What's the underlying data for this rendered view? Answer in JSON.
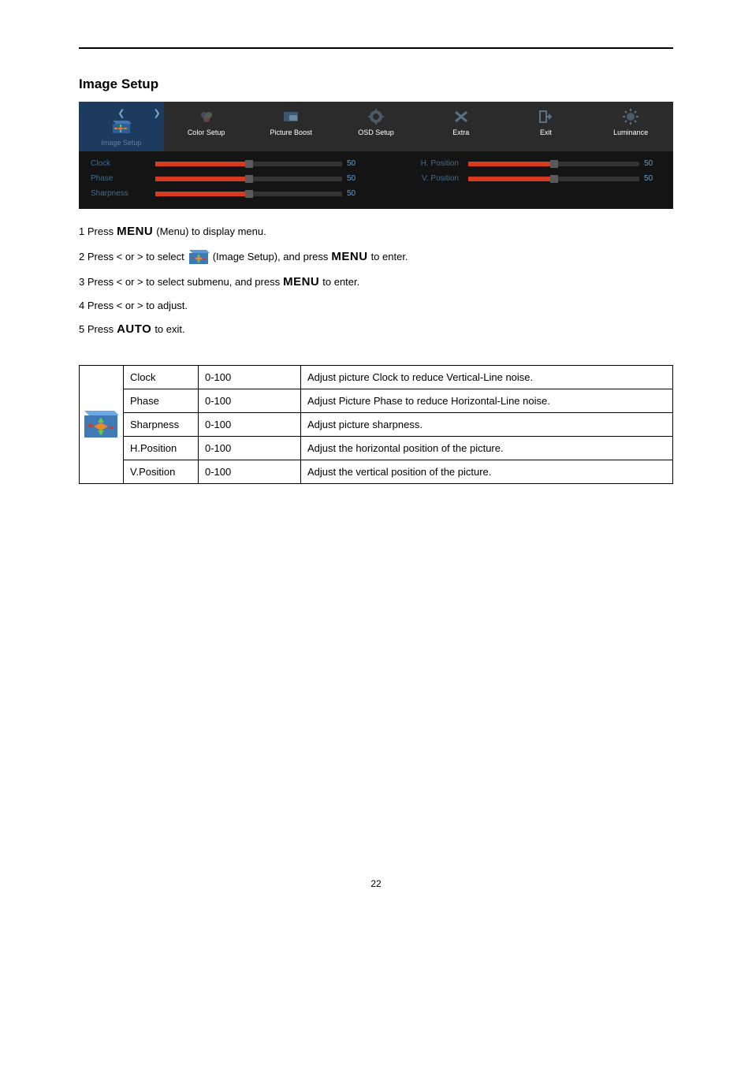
{
  "page_title": "Image Setup",
  "page_number": "22",
  "osd": {
    "tabs": [
      {
        "id": "image-setup",
        "label": "Image Setup",
        "active": true
      },
      {
        "id": "color-setup",
        "label": "Color Setup"
      },
      {
        "id": "picture-boost",
        "label": "Picture Boost"
      },
      {
        "id": "osd-setup",
        "label": "OSD Setup"
      },
      {
        "id": "extra",
        "label": "Extra"
      },
      {
        "id": "exit",
        "label": "Exit"
      },
      {
        "id": "luminance",
        "label": "Luminance"
      }
    ],
    "left": [
      {
        "label": "Clock",
        "value": "50",
        "pct": 50
      },
      {
        "label": "Phase",
        "value": "50",
        "pct": 50
      },
      {
        "label": "Sharpness",
        "value": "50",
        "pct": 50
      }
    ],
    "right": [
      {
        "label": "H. Position",
        "value": "50",
        "pct": 50
      },
      {
        "label": "V. Position",
        "value": "50",
        "pct": 50
      }
    ]
  },
  "instructions": {
    "s1a": "1 Press",
    "s1_menu": "MENU",
    "s1b": "(Menu) to display menu.",
    "s2a": "2 Press < or > to select",
    "s2b": "(Image Setup), and press",
    "s2_menu": "MENU",
    "s2c": "to enter.",
    "s3a": "3 Press < or > to select submenu, and press",
    "s3_menu": "MENU",
    "s3b": "to enter.",
    "s4": "4 Press < or > to adjust.",
    "s5a": "5 Press",
    "s5_auto": "AUTO",
    "s5b": "to exit."
  },
  "reftable": {
    "rows": [
      {
        "name": "Clock",
        "range": "0-100",
        "desc": "Adjust picture Clock to reduce Vertical-Line noise."
      },
      {
        "name": "Phase",
        "range": "0-100",
        "desc": "Adjust Picture Phase to reduce Horizontal-Line noise."
      },
      {
        "name": "Sharpness",
        "range": "0-100",
        "desc": "Adjust picture sharpness."
      },
      {
        "name": "H.Position",
        "range": "0-100",
        "desc": "Adjust the horizontal position of the picture."
      },
      {
        "name": "V.Position",
        "range": "0-100",
        "desc": "Adjust the vertical position of the picture."
      }
    ]
  }
}
